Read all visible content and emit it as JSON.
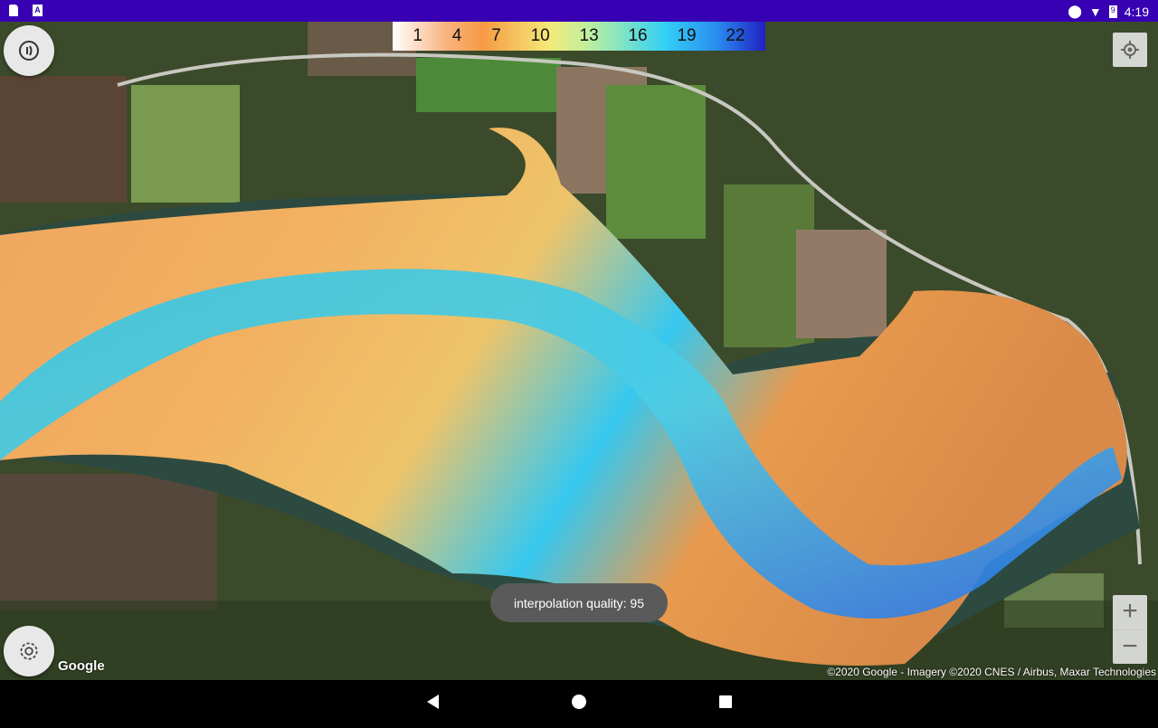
{
  "status_bar": {
    "time": "4:19",
    "battery_level": "9"
  },
  "legend": {
    "ticks": [
      "1",
      "4",
      "7",
      "10",
      "13",
      "16",
      "19",
      "22"
    ]
  },
  "toast": {
    "text": "interpolation quality: 95"
  },
  "attribution": {
    "text": "©2020 Google - Imagery ©2020 CNES / Airbus, Maxar Technologies",
    "logo": "Google"
  },
  "zoom": {
    "in": "+",
    "out": "−"
  },
  "colors": {
    "status_bar": "#3700b3",
    "shallow": "#f7a04a",
    "deep": "#1e5fe0"
  }
}
